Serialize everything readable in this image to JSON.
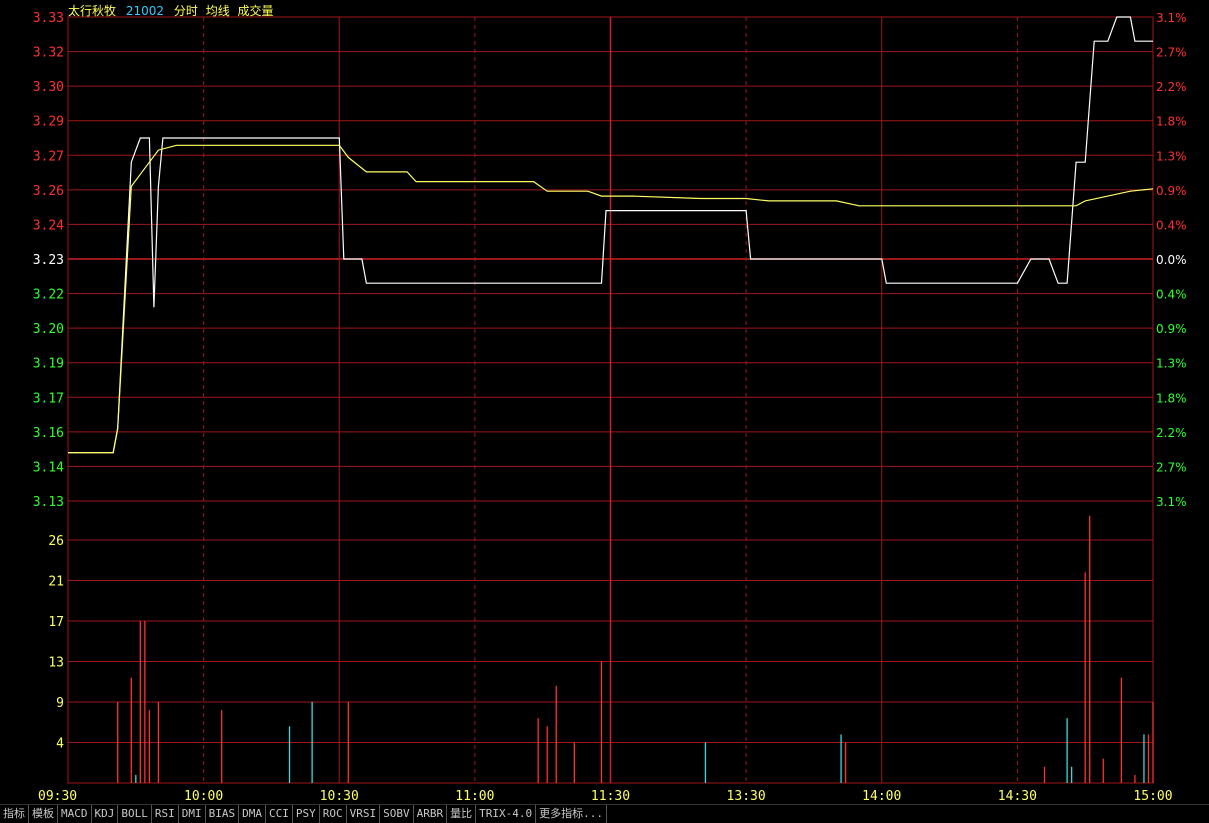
{
  "header": {
    "stock_name": "太行秋牧",
    "stock_code": "21002",
    "series_labels": [
      "分时",
      "均线",
      "成交量"
    ]
  },
  "colors": {
    "background": "#000000",
    "grid": "#a01818",
    "grid_mid": "#d02020",
    "price_line": "#ffffff",
    "avg_line": "#ffff66",
    "up_text": "#ff3030",
    "down_text": "#30ff30",
    "time_text": "#ffff66",
    "volume_up": "#ff3030",
    "volume_down": "#33dddd"
  },
  "toolbar": {
    "tabs": [
      "指标",
      "模板",
      "MACD",
      "KDJ",
      "BOLL",
      "RSI",
      "DMI",
      "BIAS",
      "DMA",
      "CCI",
      "PSY",
      "ROC",
      "VRSI",
      "SOBV",
      "ARBR",
      "量比",
      "TRIX-4.0",
      "更多指标..."
    ]
  },
  "chart_data": {
    "type": "line",
    "prev_close": 3.23,
    "price_axis": {
      "ticks": [
        3.33,
        3.32,
        3.3,
        3.29,
        3.27,
        3.26,
        3.24,
        3.23,
        3.22,
        3.2,
        3.19,
        3.17,
        3.16,
        3.14,
        3.13
      ],
      "ylim": [
        3.13,
        3.33
      ]
    },
    "percent_axis": {
      "ticks": [
        "3.1%",
        "2.7%",
        "2.2%",
        "1.8%",
        "1.3%",
        "0.9%",
        "0.4%",
        "0.0%",
        "0.4%",
        "0.9%",
        "1.3%",
        "1.8%",
        "2.2%",
        "2.7%",
        "3.1%"
      ]
    },
    "volume_axis": {
      "ticks": [
        26,
        21,
        17,
        13,
        9,
        4
      ],
      "ylim": [
        0,
        30
      ]
    },
    "time_axis": {
      "labels": [
        "09:30",
        "10:00",
        "10:30",
        "11:00",
        "11:30",
        "13:30",
        "14:00",
        "14:30",
        "15:00"
      ],
      "sessions": [
        [
          "09:30",
          "11:30"
        ],
        [
          "13:00",
          "15:00"
        ]
      ]
    },
    "series": [
      {
        "name": "分时",
        "points": [
          [
            0,
            3.15
          ],
          [
            10,
            3.15
          ],
          [
            11,
            3.16
          ],
          [
            14,
            3.27
          ],
          [
            16,
            3.28
          ],
          [
            18,
            3.28
          ],
          [
            19,
            3.21
          ],
          [
            20,
            3.26
          ],
          [
            21,
            3.28
          ],
          [
            60,
            3.28
          ],
          [
            61,
            3.23
          ],
          [
            65,
            3.23
          ],
          [
            66,
            3.22
          ],
          [
            118,
            3.22
          ],
          [
            119,
            3.25
          ],
          [
            140,
            3.25
          ],
          [
            150,
            3.25
          ],
          [
            151,
            3.23
          ],
          [
            180,
            3.23
          ],
          [
            181,
            3.22
          ],
          [
            210,
            3.22
          ],
          [
            213,
            3.23
          ],
          [
            217,
            3.23
          ],
          [
            219,
            3.22
          ],
          [
            221,
            3.22
          ],
          [
            223,
            3.27
          ],
          [
            225,
            3.27
          ],
          [
            227,
            3.32
          ],
          [
            230,
            3.32
          ],
          [
            232,
            3.33
          ],
          [
            235,
            3.33
          ],
          [
            236,
            3.32
          ],
          [
            240,
            3.32
          ]
        ]
      },
      {
        "name": "均线",
        "points": [
          [
            0,
            3.15
          ],
          [
            10,
            3.15
          ],
          [
            11,
            3.16
          ],
          [
            14,
            3.26
          ],
          [
            16,
            3.265
          ],
          [
            18,
            3.27
          ],
          [
            20,
            3.275
          ],
          [
            24,
            3.277
          ],
          [
            40,
            3.277
          ],
          [
            60,
            3.277
          ],
          [
            62,
            3.272
          ],
          [
            66,
            3.266
          ],
          [
            75,
            3.266
          ],
          [
            77,
            3.262
          ],
          [
            100,
            3.262
          ],
          [
            103,
            3.262
          ],
          [
            106,
            3.258
          ],
          [
            110,
            3.258
          ],
          [
            115,
            3.258
          ],
          [
            118,
            3.256
          ],
          [
            125,
            3.256
          ],
          [
            140,
            3.255
          ],
          [
            150,
            3.255
          ],
          [
            155,
            3.254
          ],
          [
            170,
            3.254
          ],
          [
            175,
            3.252
          ],
          [
            185,
            3.252
          ],
          [
            200,
            3.252
          ],
          [
            210,
            3.252
          ],
          [
            216,
            3.252
          ],
          [
            222,
            3.252
          ],
          [
            223,
            3.252
          ],
          [
            225,
            3.254
          ],
          [
            230,
            3.256
          ],
          [
            235,
            3.258
          ],
          [
            240,
            3.259
          ]
        ]
      }
    ],
    "volume": [
      {
        "t": 11,
        "v": 10,
        "dir": "up"
      },
      {
        "t": 14,
        "v": 13,
        "dir": "up"
      },
      {
        "t": 15,
        "v": 1,
        "dir": "down"
      },
      {
        "t": 16,
        "v": 20,
        "dir": "up"
      },
      {
        "t": 17,
        "v": 20,
        "dir": "up"
      },
      {
        "t": 18,
        "v": 9,
        "dir": "up"
      },
      {
        "t": 20,
        "v": 10,
        "dir": "up"
      },
      {
        "t": 34,
        "v": 9,
        "dir": "up"
      },
      {
        "t": 49,
        "v": 7,
        "dir": "down"
      },
      {
        "t": 54,
        "v": 10,
        "dir": "down"
      },
      {
        "t": 62,
        "v": 10,
        "dir": "up"
      },
      {
        "t": 104,
        "v": 8,
        "dir": "up"
      },
      {
        "t": 106,
        "v": 7,
        "dir": "up"
      },
      {
        "t": 108,
        "v": 12,
        "dir": "up"
      },
      {
        "t": 112,
        "v": 5,
        "dir": "up"
      },
      {
        "t": 118,
        "v": 15,
        "dir": "up"
      },
      {
        "t": 141,
        "v": 5,
        "dir": "down"
      },
      {
        "t": 171,
        "v": 6,
        "dir": "down"
      },
      {
        "t": 172,
        "v": 5,
        "dir": "up"
      },
      {
        "t": 216,
        "v": 2,
        "dir": "up"
      },
      {
        "t": 221,
        "v": 8,
        "dir": "down"
      },
      {
        "t": 222,
        "v": 2,
        "dir": "down"
      },
      {
        "t": 225,
        "v": 26,
        "dir": "up"
      },
      {
        "t": 226,
        "v": 33,
        "dir": "up"
      },
      {
        "t": 229,
        "v": 3,
        "dir": "up"
      },
      {
        "t": 233,
        "v": 13,
        "dir": "up"
      },
      {
        "t": 236,
        "v": 1,
        "dir": "up"
      },
      {
        "t": 238,
        "v": 6,
        "dir": "down"
      },
      {
        "t": 239,
        "v": 6,
        "dir": "up"
      },
      {
        "t": 240,
        "v": 10,
        "dir": "up"
      }
    ]
  }
}
